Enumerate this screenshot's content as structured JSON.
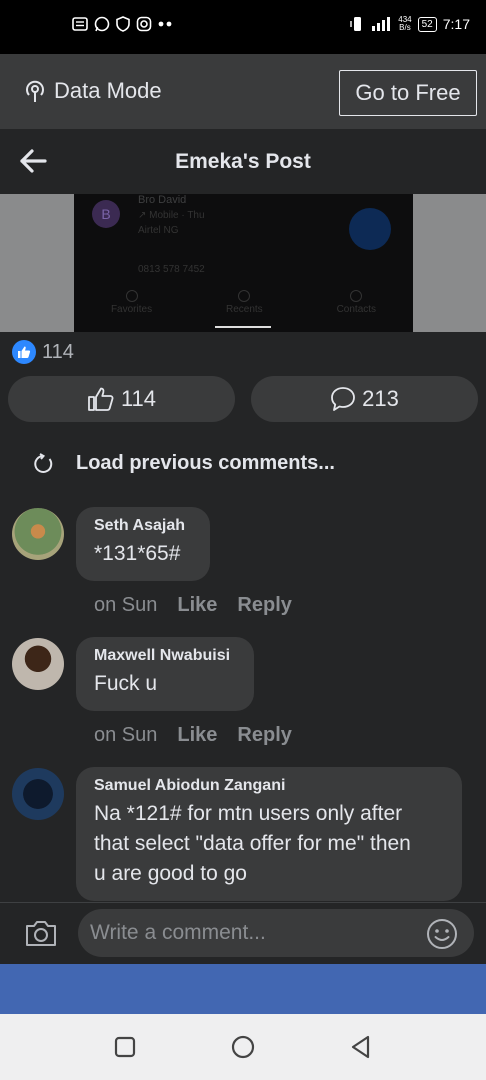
{
  "status_bar": {
    "network_speed_value": "434",
    "network_speed_unit": "B/s",
    "battery": "52",
    "time": "7:17",
    "icons": [
      "notification-icon",
      "whatsapp-icon",
      "shield-icon",
      "instagram-icon",
      "more-dots-icon",
      "vibrate-icon",
      "signal-icon"
    ]
  },
  "data_mode": {
    "label": "Data Mode",
    "switch_button": "Go to Free"
  },
  "header": {
    "title": "Emeka's Post"
  },
  "post_image": {
    "avatar_letter": "B",
    "contact_name": "Bro David",
    "contact_sub": "↗ Mobile · Thu",
    "contact_carrier": "Airtel NG",
    "number": "0813 578 7452",
    "tabs": [
      "Favorites",
      "Recents",
      "Contacts"
    ]
  },
  "reactions": {
    "count": "114"
  },
  "actions": {
    "like_count": "114",
    "comment_count": "213"
  },
  "load_previous": "Load previous comments...",
  "comments": [
    {
      "author": "Seth Asajah",
      "text": "*131*65#",
      "time": "on Sun",
      "like": "Like",
      "reply": "Reply"
    },
    {
      "author": "Maxwell Nwabuisi",
      "text": "Fuck u",
      "time": "on Sun",
      "like": "Like",
      "reply": "Reply"
    },
    {
      "author": "Samuel Abiodun Zangani",
      "text_lines": [
        "Na *121# for mtn users only after",
        "that select \"data offer for me\" then",
        "u are good to go"
      ]
    }
  ],
  "composer": {
    "placeholder": "Write a comment..."
  },
  "colors": {
    "background": "#242526",
    "surface": "#3a3b3c",
    "text": "#e4e6eb",
    "muted": "#8a8d91",
    "accent_blue": "#2d88ff",
    "fb_blue": "#4267b2"
  }
}
